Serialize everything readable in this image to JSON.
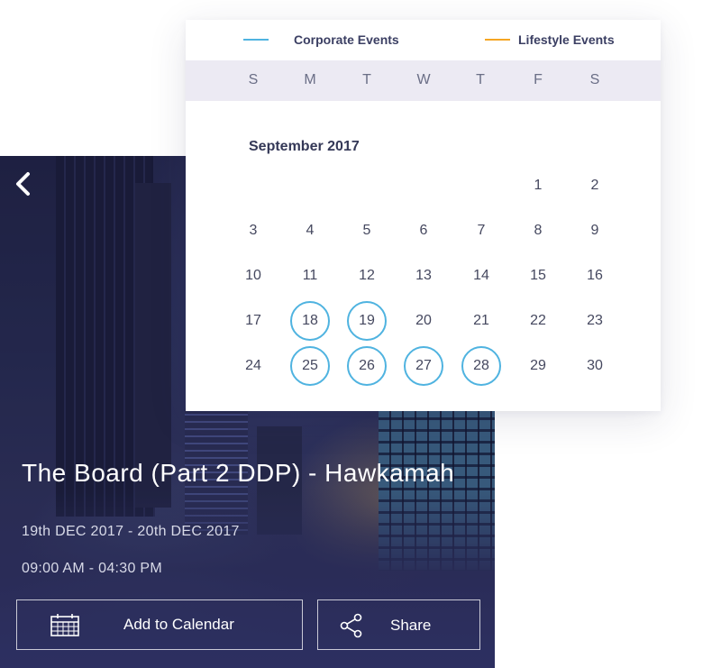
{
  "event": {
    "back_label": "Back",
    "title": "The Board (Part 2 DDP) - Hawkamah",
    "dates": "19th DEC 2017 - 20th DEC 2017",
    "time": "09:00 AM - 04:30 PM",
    "add_to_calendar_label": "Add to Calendar",
    "share_label": "Share",
    "icons": {
      "back": "chevron-left-icon",
      "calendar": "calendar-icon",
      "share": "share-icon"
    }
  },
  "calendar": {
    "legend": [
      {
        "label": "Corporate Events",
        "color": "#4fb3e0"
      },
      {
        "label": "Lifestyle Events",
        "color": "#f5a623"
      }
    ],
    "weekdays": [
      "S",
      "M",
      "T",
      "W",
      "T",
      "F",
      "S"
    ],
    "month_label": "September 2017",
    "weeks": [
      [
        null,
        null,
        null,
        null,
        null,
        1,
        2
      ],
      [
        3,
        4,
        5,
        6,
        7,
        8,
        9
      ],
      [
        10,
        11,
        12,
        13,
        14,
        15,
        16
      ],
      [
        17,
        18,
        19,
        20,
        21,
        22,
        23
      ],
      [
        24,
        25,
        26,
        27,
        28,
        29,
        30
      ]
    ],
    "corporate_event_days": [
      18,
      19,
      25,
      26,
      27,
      28
    ],
    "lifestyle_event_days": []
  }
}
